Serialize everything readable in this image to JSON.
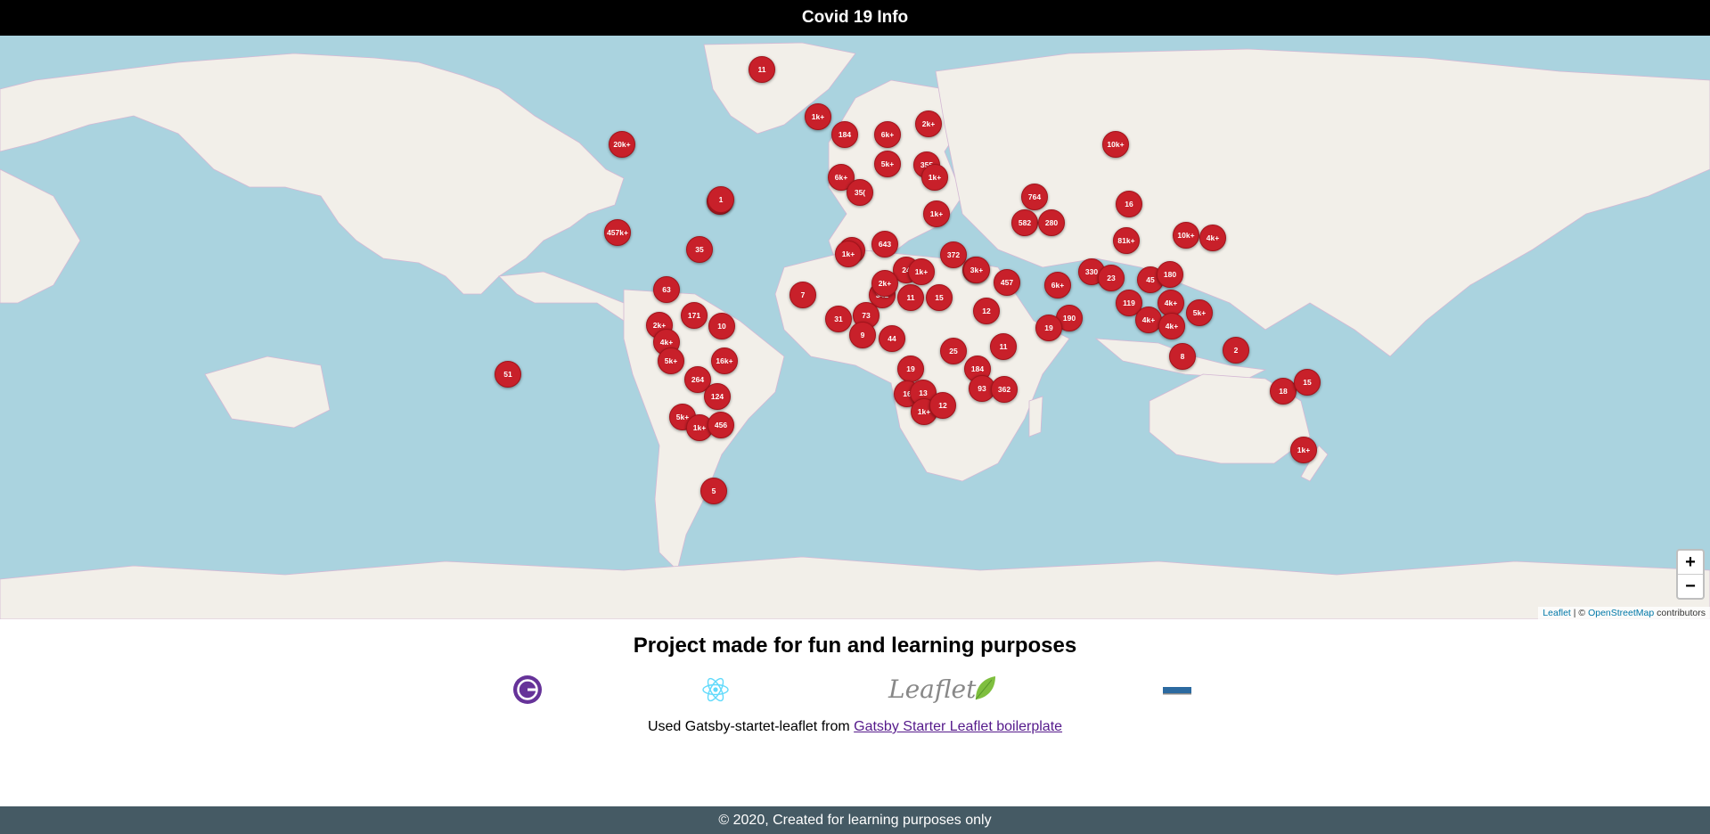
{
  "header": {
    "title": "Covid 19 Info"
  },
  "map": {
    "zoom_in": "+",
    "zoom_out": "−",
    "attribution": {
      "leaflet": "Leaflet",
      "separator": " | © ",
      "osm": "OpenStreetMap",
      "contributors": " contributors"
    },
    "marker_color": "#c8202a",
    "markers": [
      "11",
      "1k+",
      "184",
      "6k+",
      "2k+",
      "355",
      "1k+",
      "20k+",
      "1",
      "10k+",
      "5k+",
      "6k+",
      "35(",
      "1k+",
      "764",
      "16",
      "457k+",
      "582",
      "280",
      "81k+",
      "10k+",
      "4k+",
      "35",
      "643",
      "1k+",
      "372",
      "457",
      "3k+",
      "330",
      "23",
      "45",
      "180",
      "6k+",
      "63",
      "171",
      "2k+",
      "10",
      "1k+",
      "24",
      "342",
      "11",
      "15",
      "12",
      "3k+",
      "119",
      "4k+",
      "7",
      "73",
      "31",
      "9",
      "44",
      "19",
      "11",
      "2k+",
      "1k+",
      "4k+",
      "5k+",
      "16k+",
      "51",
      "264",
      "124",
      "5k+",
      "1k+",
      "456",
      "184",
      "93",
      "362",
      "16",
      "13",
      "1k+",
      "12",
      "18",
      "15",
      "1k+",
      "2",
      "5",
      "1",
      "8",
      "190",
      "5k+",
      "4k+",
      "4k+",
      "25",
      "19"
    ]
  },
  "content": {
    "heading": "Project made for fun and learning purposes",
    "logos": [
      {
        "name": "Gatsby"
      },
      {
        "name": "React"
      },
      {
        "name": "Leaflet"
      },
      {
        "name": "GeoJSON"
      }
    ],
    "credit_text": "Used Gatsby-startet-leaflet from ",
    "credit_link": "Gatsby Starter Leaflet boilerplate"
  },
  "footer": {
    "text": "© 2020, Created for learning purposes only"
  }
}
